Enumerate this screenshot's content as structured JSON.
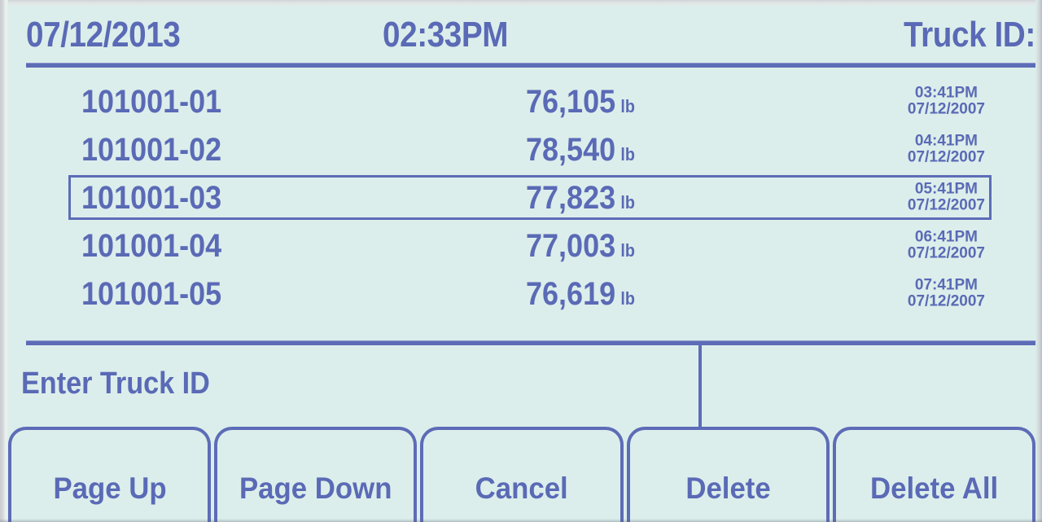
{
  "header": {
    "date": "07/12/2013",
    "time": "02:33PM",
    "truck_id_label": "Truck ID:"
  },
  "colors": {
    "background": "#dceeeb",
    "accent": "#5d6cb7",
    "text": "#5a6ab6"
  },
  "list": {
    "unit": "lb",
    "rows": [
      {
        "id": "101001-01",
        "weight": "76,105",
        "unit": "lb",
        "time": "03:41PM",
        "date": "07/12/2007",
        "selected": false
      },
      {
        "id": "101001-02",
        "weight": "78,540",
        "unit": "lb",
        "time": "04:41PM",
        "date": "07/12/2007",
        "selected": false
      },
      {
        "id": "101001-03",
        "weight": "77,823",
        "unit": "lb",
        "time": "05:41PM",
        "date": "07/12/2007",
        "selected": true
      },
      {
        "id": "101001-04",
        "weight": "77,003",
        "unit": "lb",
        "time": "06:41PM",
        "date": "07/12/2007",
        "selected": false
      },
      {
        "id": "101001-05",
        "weight": "76,619",
        "unit": "lb",
        "time": "07:41PM",
        "date": "07/12/2007",
        "selected": false
      }
    ]
  },
  "entry": {
    "prompt": "Enter Truck ID",
    "value": ""
  },
  "buttons": [
    {
      "label": "Page Up",
      "name": "page-up-button"
    },
    {
      "label": "Page Down",
      "name": "page-down-button"
    },
    {
      "label": "Cancel",
      "name": "cancel-button"
    },
    {
      "label": "Delete",
      "name": "delete-button"
    },
    {
      "label": "Delete All",
      "name": "delete-all-button"
    }
  ]
}
